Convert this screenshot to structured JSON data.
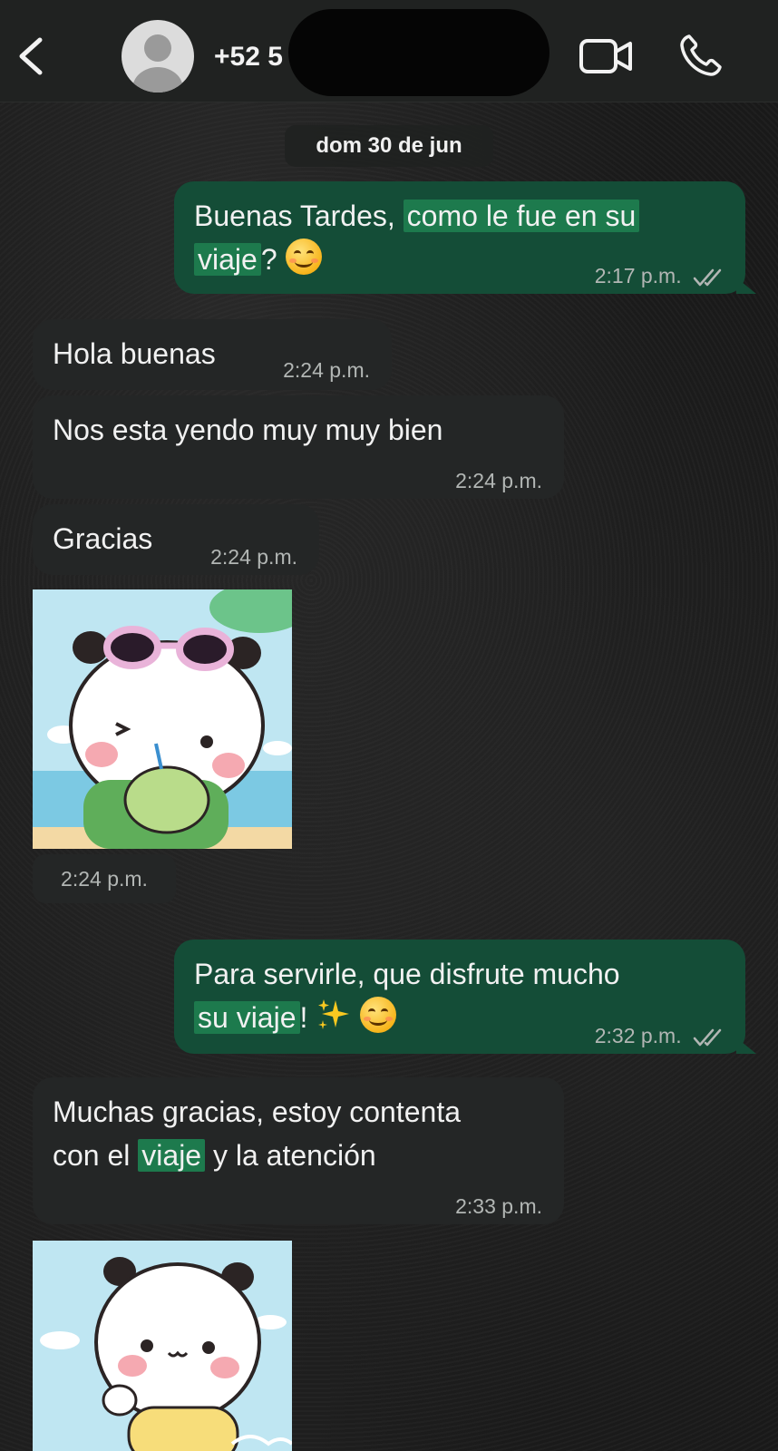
{
  "header": {
    "back_icon": "chevron-left-icon",
    "contact_name": "+52 5",
    "video_icon": "video-camera-icon",
    "call_icon": "phone-icon"
  },
  "date_separator": "dom 30 de jun",
  "messages": [
    {
      "direction": "outgoing",
      "text_plain": "Buenas Tardes, ",
      "text_highlight_1": "como le fue en su",
      "text_highlight_2": "viaje",
      "text_tail": "?",
      "emoji": "smiling-face",
      "time": "2:17 p.m.",
      "status": "read-double-check"
    },
    {
      "direction": "incoming",
      "text": "Hola buenas",
      "time": "2:24 p.m."
    },
    {
      "direction": "incoming",
      "text": "Nos esta yendo muy muy bien",
      "time": "2:24 p.m."
    },
    {
      "direction": "incoming",
      "text": "Gracias",
      "time": "2:24 p.m."
    },
    {
      "direction": "incoming",
      "type": "sticker",
      "sticker": "panda-beach-coconut-sticker",
      "time": "2:24 p.m."
    },
    {
      "direction": "outgoing",
      "text_plain": "Para servirle, que disfrute mucho",
      "text_highlight": "su viaje",
      "text_tail": "!",
      "emoji": "sparkles-and-smiling-face",
      "time": "2:32 p.m.",
      "status": "read-double-check"
    },
    {
      "direction": "incoming",
      "text_line1": "Muchas gracias, estoy contenta",
      "text_before": "con el ",
      "text_highlight": "viaje",
      "text_after": " y la atención",
      "time": "2:33 p.m."
    },
    {
      "direction": "incoming",
      "type": "sticker",
      "sticker": "panda-waving-sticker"
    }
  ],
  "colors": {
    "incoming_bubble": "#242626",
    "outgoing_bubble": "#144d37",
    "highlight": "#1d7a4d",
    "header": "#202221"
  }
}
